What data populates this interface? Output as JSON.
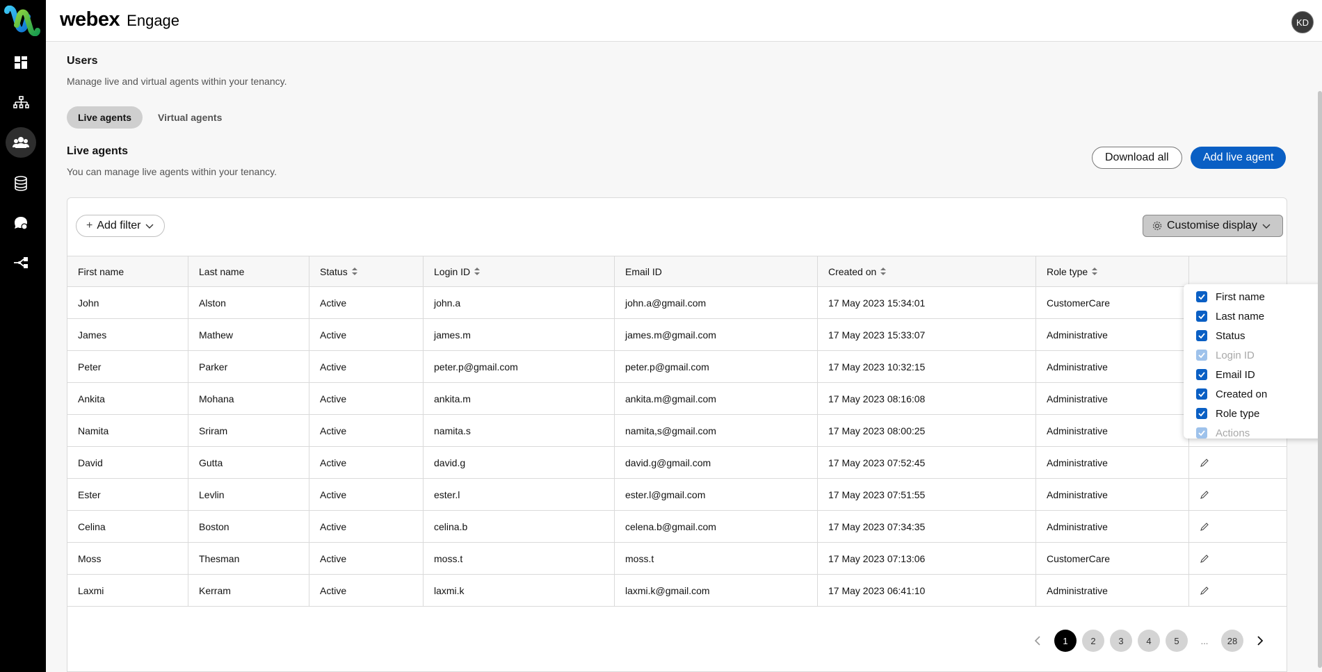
{
  "app": {
    "brand_main": "webex",
    "brand_product": "Engage",
    "avatar_initials": "KD",
    "accent": "#0a5fc4"
  },
  "sidebar": {
    "items": [
      {
        "name": "dashboard",
        "active": false
      },
      {
        "name": "routing",
        "active": false
      },
      {
        "name": "users",
        "active": true
      },
      {
        "name": "database",
        "active": false
      },
      {
        "name": "chat",
        "active": false
      },
      {
        "name": "integrations",
        "active": false
      }
    ]
  },
  "page": {
    "title": "Users",
    "subtitle": "Manage live and virtual agents within your tenancy.",
    "tabs": [
      {
        "label": "Live agents",
        "active": true
      },
      {
        "label": "Virtual agents",
        "active": false
      }
    ],
    "section_title": "Live agents",
    "section_subtitle": "You can manage live agents within your tenancy.",
    "download_all_label": "Download all",
    "add_live_agent_label": "Add live agent",
    "add_filter_label": "Add filter",
    "customise_display_label": "Customise display"
  },
  "table": {
    "columns": [
      "First name",
      "Last name",
      "Status",
      "Login ID",
      "Email ID",
      "Created on",
      "Role type",
      ""
    ],
    "rows": [
      [
        "John",
        "Alston",
        "Active",
        "john.a",
        "john.a@gmail.com",
        "17 May 2023 15:34:01",
        "CustomerCare"
      ],
      [
        "James",
        "Mathew",
        "Active",
        "james.m",
        "james.m@gmail.com",
        "17 May 2023 15:33:07",
        "Administrative"
      ],
      [
        "Peter",
        "Parker",
        "Active",
        "peter.p@gmail.com",
        "peter.p@gmail.com",
        "17 May 2023 10:32:15",
        "Administrative"
      ],
      [
        "Ankita",
        "Mohana",
        "Active",
        "ankita.m",
        "ankita.m@gmail.com",
        "17 May 2023 08:16:08",
        "Administrative"
      ],
      [
        "Namita",
        "Sriram",
        "Active",
        "namita.s",
        "namita,s@gmail.com",
        "17 May 2023 08:00:25",
        "Administrative"
      ],
      [
        "David",
        "Gutta",
        "Active",
        "david.g",
        "david.g@gmail.com",
        "17 May 2023 07:52:45",
        "Administrative"
      ],
      [
        "Ester",
        "Levlin",
        "Active",
        "ester.l",
        "ester.l@gmail.com",
        "17 May 2023 07:51:55",
        "Administrative"
      ],
      [
        "Celina",
        "Boston",
        "Active",
        "celina.b",
        "celena.b@gmail.com",
        "17 May 2023 07:34:35",
        "Administrative"
      ],
      [
        "Moss",
        "Thesman",
        "Active",
        "moss.t",
        "moss.t",
        "17 May 2023 07:13:06",
        "CustomerCare"
      ],
      [
        "Laxmi",
        "Kerram",
        "Active",
        "laxmi.k",
        "laxmi.k@gmail.com",
        "17 May 2023 06:41:10",
        "Administrative"
      ]
    ]
  },
  "customise_menu": [
    {
      "label": "First name",
      "checked": true,
      "disabled": false
    },
    {
      "label": "Last name",
      "checked": true,
      "disabled": false
    },
    {
      "label": "Status",
      "checked": true,
      "disabled": false
    },
    {
      "label": "Login ID",
      "checked": true,
      "disabled": true
    },
    {
      "label": "Email ID",
      "checked": true,
      "disabled": false
    },
    {
      "label": "Created on",
      "checked": true,
      "disabled": false
    },
    {
      "label": "Role type",
      "checked": true,
      "disabled": false
    },
    {
      "label": "Actions",
      "checked": true,
      "disabled": true
    }
  ],
  "pagination": {
    "pages": [
      "1",
      "2",
      "3",
      "4",
      "5"
    ],
    "current": "1",
    "ellipsis": "...",
    "last": "28"
  }
}
